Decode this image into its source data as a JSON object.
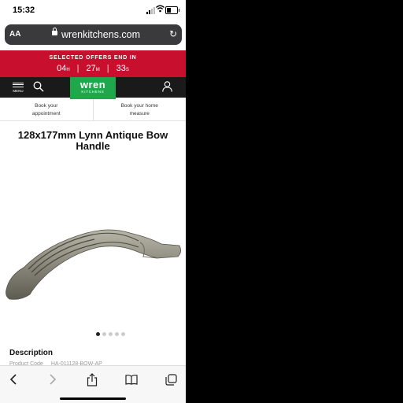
{
  "status": {
    "time": "15:32"
  },
  "browser": {
    "aa": "AA",
    "url": "wrenkitchens.com",
    "reload": "↻"
  },
  "offers": {
    "title": "SELECTED OFFERS END IN",
    "hours": "04",
    "hours_unit": "H",
    "minutes": "27",
    "minutes_unit": "M",
    "seconds": "33",
    "seconds_unit": "S",
    "separator": "|"
  },
  "nav": {
    "menu_label": "MENU",
    "logo_main": "wren",
    "logo_sub": "KITCHENS"
  },
  "booking": {
    "appointment_line1": "Book your",
    "appointment_line2": "appointment",
    "measure_line1": "Book your home",
    "measure_line2": "measure"
  },
  "product": {
    "title_line1": "128x177mm Lynn Antique Bow",
    "title_line2": "Handle",
    "description_heading": "Description",
    "code_label": "Product Code",
    "code_value": "HA-011128-BOW-AP"
  },
  "gallery": {
    "total": 5,
    "active": 0
  },
  "colors": {
    "banner": "#c8102e",
    "nav": "#1a1a1a",
    "logo": "#1ea84b"
  }
}
